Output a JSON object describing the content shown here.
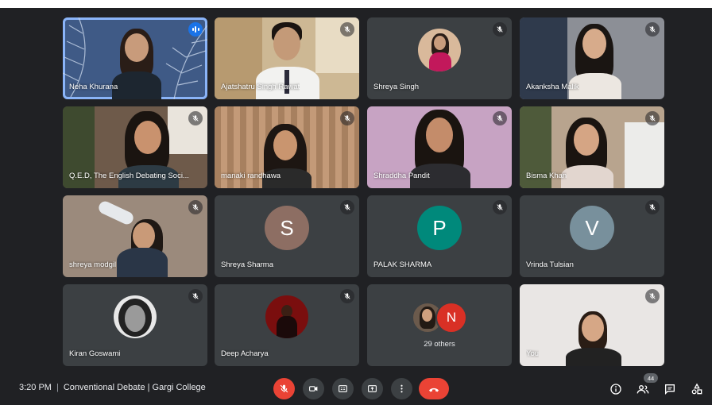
{
  "meeting": {
    "time": "3:20 PM",
    "separator": "|",
    "title": "Conventional Debate | Gargi College",
    "participant_count": "44"
  },
  "tiles": [
    {
      "name": "Neha Khurana",
      "kind": "video",
      "speaking": true
    },
    {
      "name": "Ajatshatru Singh Rawat",
      "kind": "video"
    },
    {
      "name": "Shreya Singh",
      "kind": "photo"
    },
    {
      "name": "Akanksha Malik",
      "kind": "video"
    },
    {
      "name": "Q.E.D, The English Debating Soci...",
      "kind": "video"
    },
    {
      "name": "manaki randhawa",
      "kind": "video"
    },
    {
      "name": "Shraddha Pandit",
      "kind": "video"
    },
    {
      "name": "Bisma Khan",
      "kind": "video"
    },
    {
      "name": "shreya modgil",
      "kind": "video"
    },
    {
      "name": "Shreya Sharma",
      "kind": "letter",
      "letter": "S",
      "color": "#8d6e63"
    },
    {
      "name": "PALAK SHARMA",
      "kind": "letter",
      "letter": "P",
      "color": "#00897b"
    },
    {
      "name": "Vrinda Tulsian",
      "kind": "letter",
      "letter": "V",
      "color": "#78909c"
    },
    {
      "name": "Kiran Goswami",
      "kind": "photo"
    },
    {
      "name": "Deep Acharya",
      "kind": "photo"
    },
    {
      "name": "29 others",
      "kind": "others",
      "letter": "N",
      "color": "#d93025"
    },
    {
      "name": "You",
      "kind": "video"
    }
  ],
  "icons": {
    "mic_off": "mic-off-icon",
    "camera": "camera-icon",
    "captions": "captions-icon",
    "present": "present-icon",
    "more": "more-vert-icon",
    "end_call": "end-call-icon",
    "info": "info-icon",
    "people": "people-icon",
    "chat": "chat-icon",
    "activities": "activities-icon"
  },
  "colors": {
    "background": "#202124",
    "tile": "#3c4043",
    "danger": "#ea4335",
    "speaking": "#8ab4f8"
  }
}
